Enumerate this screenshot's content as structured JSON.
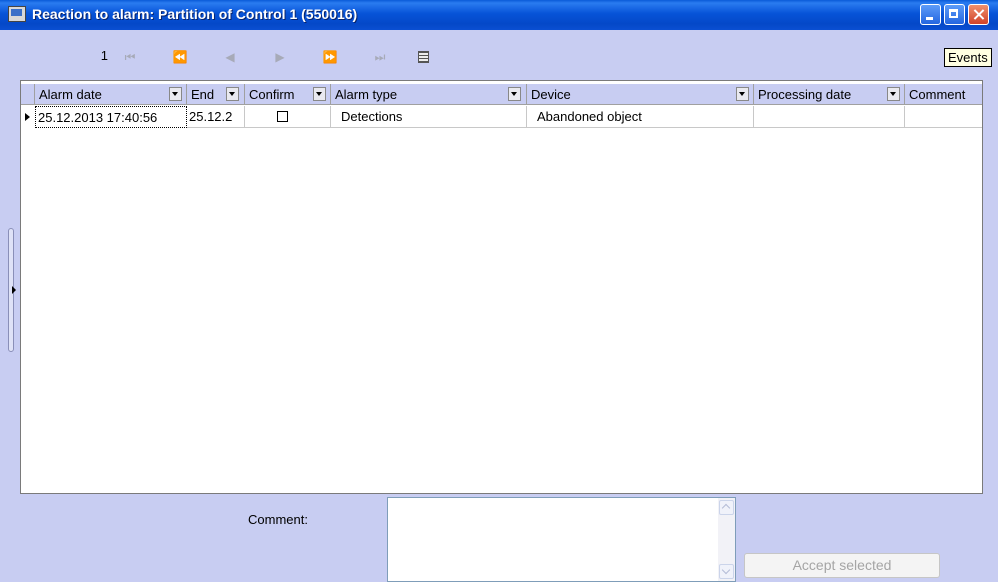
{
  "window": {
    "title": "Reaction to alarm: Partition of Control 1  (550016)",
    "tooltip": "Events"
  },
  "navigator": {
    "current_record": "1"
  },
  "grid": {
    "columns": [
      "Alarm date",
      "End",
      "Confirm",
      "Alarm type",
      "Device",
      "Processing date",
      "Comment"
    ],
    "rows": [
      {
        "alarm_date": "25.12.2013 17:40:56",
        "end": "25.12.2",
        "confirm_checked": false,
        "alarm_type": "Detections",
        "device": "Abandoned object",
        "processing_date": "",
        "comment": ""
      }
    ]
  },
  "footer": {
    "comment_label": "Comment:",
    "comment_value": "",
    "accept_label": "Accept selected"
  }
}
